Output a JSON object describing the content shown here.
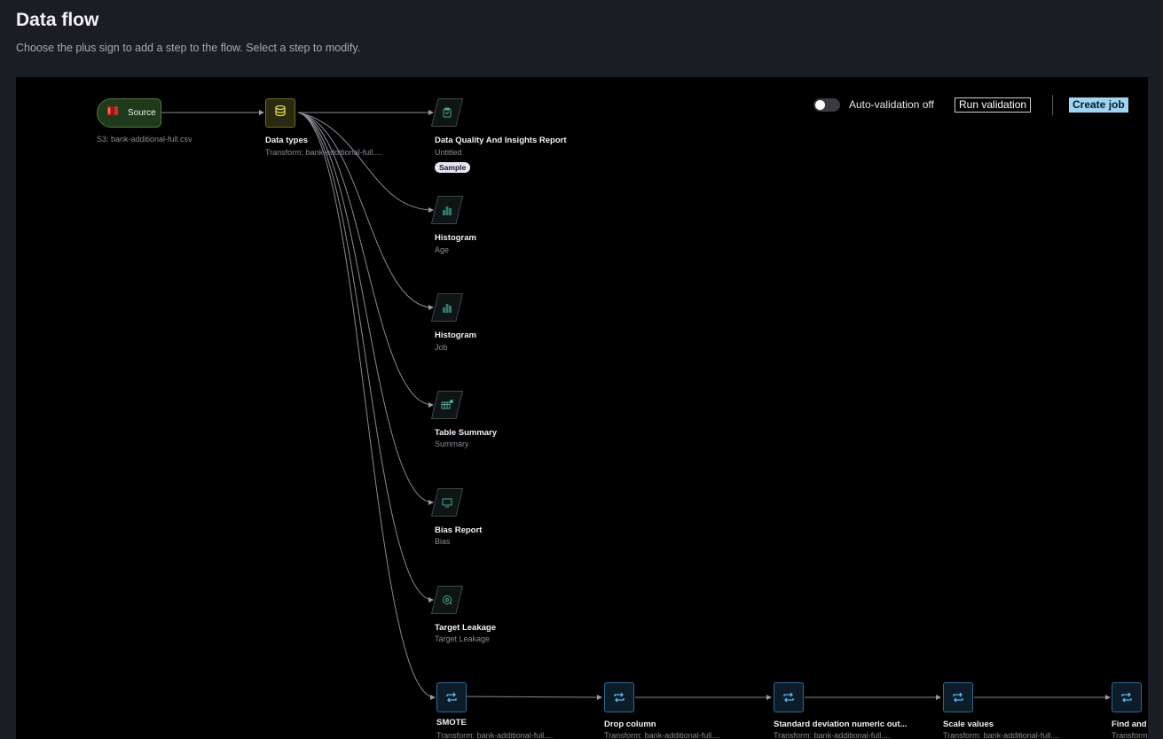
{
  "header": {
    "title": "Data flow",
    "subtitle": "Choose the plus sign to add a step to the flow. Select a step to modify."
  },
  "toolbar": {
    "auto_validation_label": "Auto-validation off",
    "auto_validation_on": false,
    "run_validation_label": "Run validation",
    "create_job_label": "Create job"
  },
  "source": {
    "label": "Source",
    "subtitle": "S3: bank-additional-full.csv"
  },
  "data_types": {
    "title": "Data types",
    "subtitle": "Transform: bank-additional-full...."
  },
  "analyses": [
    {
      "title": "Data Quality And Insights Report",
      "subtitle": "Untitled",
      "badge": "Sample",
      "icon": "clipboard-icon"
    },
    {
      "title": "Histogram",
      "subtitle": "Age",
      "icon": "bar-chart-icon"
    },
    {
      "title": "Histogram",
      "subtitle": "Job",
      "icon": "bar-chart-icon"
    },
    {
      "title": "Table Summary",
      "subtitle": "Summary",
      "icon": "table-icon"
    },
    {
      "title": "Bias Report",
      "subtitle": "Bias",
      "icon": "monitor-icon"
    },
    {
      "title": "Target Leakage",
      "subtitle": "Target Leakage",
      "icon": "target-icon"
    }
  ],
  "transforms": [
    {
      "title": "SMOTE",
      "subtitle": "Transform: bank-additional-full...."
    },
    {
      "title": "Drop column",
      "subtitle": "Transform: bank-additional-full...."
    },
    {
      "title": "Standard deviation numeric out...",
      "subtitle": "Transform: bank-additional-full...."
    },
    {
      "title": "Scale values",
      "subtitle": "Transform: bank-additional-full...."
    },
    {
      "title": "Find and r",
      "subtitle": "Transform"
    }
  ],
  "colors": {
    "source": "#4f7a3a",
    "data_types": "#6f6a20",
    "analysis": "#2a5a4e",
    "transform": "#2b6b93",
    "accent": "#9fd4f5"
  }
}
